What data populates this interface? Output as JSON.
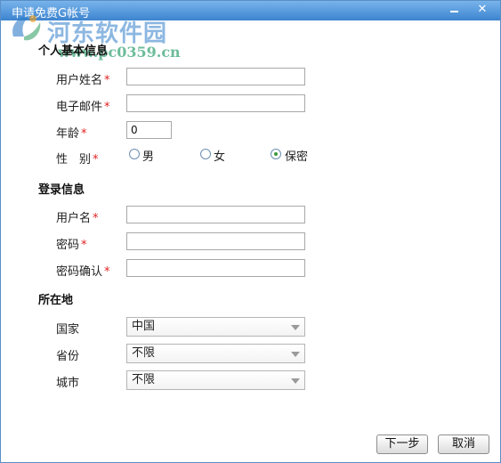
{
  "window": {
    "title": "申请免费G帐号",
    "minimize_icon": "minimize-icon",
    "close_icon": "close-icon",
    "close_glyph": "✕"
  },
  "watermark": {
    "text": "河东软件园",
    "url": "www.pc0359.cn"
  },
  "sections": {
    "personal": "个人基本信息",
    "login": "登录信息",
    "location": "所在地"
  },
  "personal": {
    "username_label": "用户姓名",
    "email_label": "电子邮件",
    "age_label": "年龄",
    "age_value": "0",
    "gender_label": "性　别",
    "gender_options": [
      "男",
      "女",
      "保密"
    ],
    "gender_selected": "保密"
  },
  "login": {
    "account_label": "用户名",
    "password_label": "密码",
    "confirm_label": "密码确认"
  },
  "location": {
    "country_label": "国家",
    "country_value": "中国",
    "province_label": "省份",
    "province_value": "不限",
    "city_label": "城市",
    "city_value": "不限"
  },
  "required_mark": "*",
  "buttons": {
    "next": "下一步",
    "cancel": "取消"
  },
  "colors": {
    "titlebar": "#3d84cf",
    "required": "#e02020",
    "radio_selected": "#3a9a3a"
  }
}
